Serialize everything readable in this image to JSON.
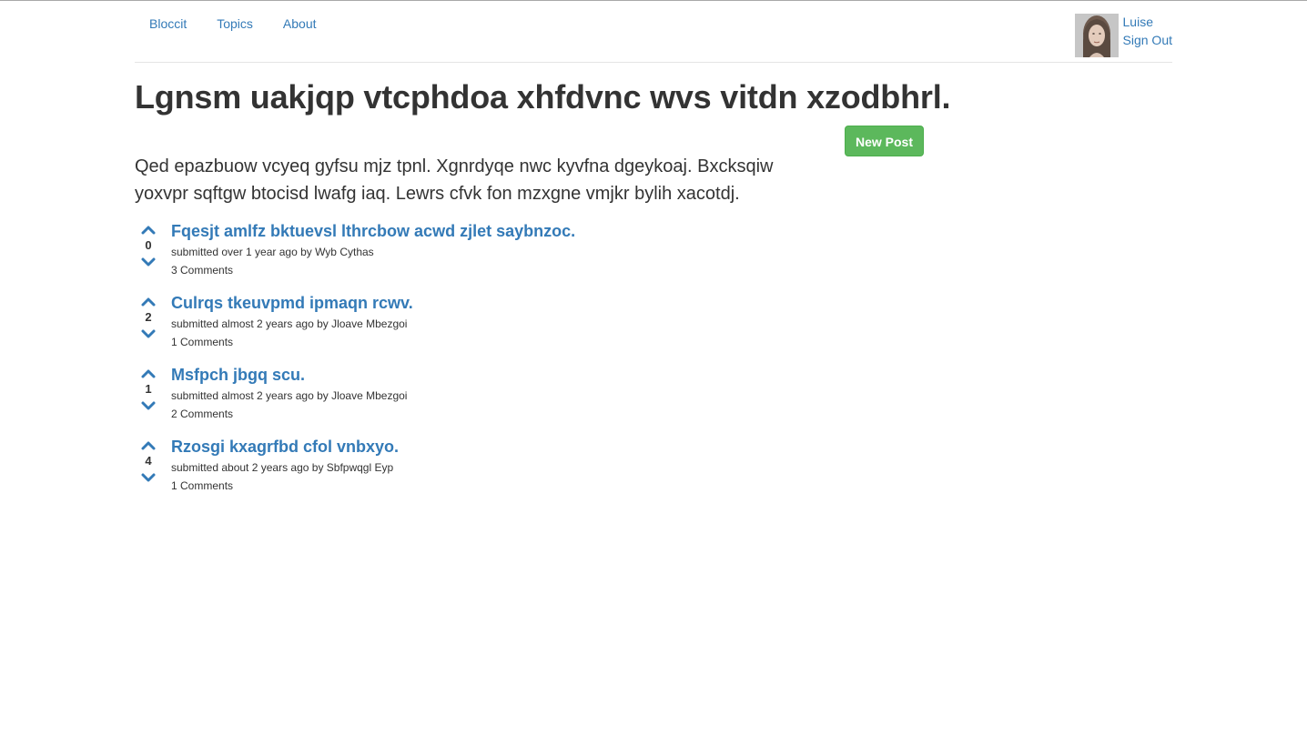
{
  "nav": {
    "brand": "Bloccit",
    "topics": "Topics",
    "about": "About"
  },
  "user": {
    "name": "Luise",
    "sign_out": "Sign Out"
  },
  "topic": {
    "title": "Lgnsm uakjqp vtcphdoa xhfdvnc wvs vitdn xzodbhrl.",
    "description": "Qed epazbuow vcyeq gyfsu mjz tpnl. Xgnrdyqe nwc kyvfna dgeykoaj. Bxcksqiw yoxvpr sqftgw btocisd lwafg iaq. Lewrs cfvk fon mzxgne vmjkr bylih xacotdj.",
    "new_post_label": "New Post"
  },
  "posts": [
    {
      "votes": "0",
      "title": "Fqesjt amlfz bktuevsl lthrcbow acwd zjlet saybnzoc.",
      "meta": "submitted over 1 year ago by Wyb Cythas",
      "comments": "3 Comments"
    },
    {
      "votes": "2",
      "title": "Culrqs tkeuvpmd ipmaqn rcwv.",
      "meta": "submitted almost 2 years ago by Jloave Mbezgoi",
      "comments": "1 Comments"
    },
    {
      "votes": "1",
      "title": "Msfpch jbgq scu.",
      "meta": "submitted almost 2 years ago by Jloave Mbezgoi",
      "comments": "2 Comments"
    },
    {
      "votes": "4",
      "title": "Rzosgi kxagrfbd cfol vnbxyo.",
      "meta": "submitted about 2 years ago by Sbfpwqgl Eyp",
      "comments": "1 Comments"
    }
  ],
  "icons": {
    "upvote": "chevron-up-icon",
    "downvote": "chevron-down-icon",
    "avatar": "user-avatar"
  },
  "colors": {
    "link": "#337ab7",
    "success": "#5cb85c",
    "text": "#333333"
  }
}
